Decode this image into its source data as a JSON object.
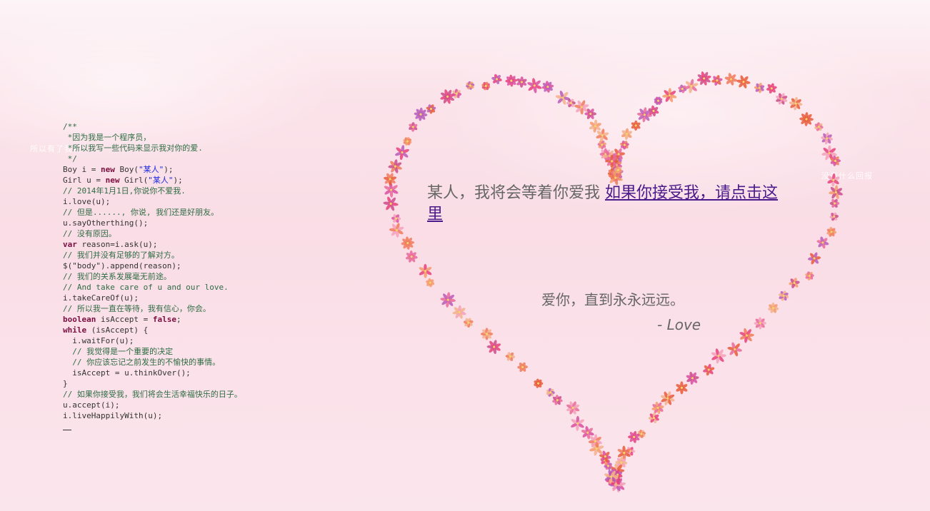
{
  "background_texts": {
    "left": "所以有了我们",
    "right": "没有什么回报"
  },
  "code_lines": [
    [
      {
        "t": "/**",
        "c": "cmt"
      }
    ],
    [
      {
        "t": " *因为我是一个程序员，",
        "c": "cmt"
      }
    ],
    [
      {
        "t": " *所以我写一些代码来显示我对你的爱.",
        "c": "cmt"
      }
    ],
    [
      {
        "t": " */",
        "c": "cmt"
      }
    ],
    [
      {
        "t": "Boy i = ",
        "c": ""
      },
      {
        "t": "new",
        "c": "kw"
      },
      {
        "t": " Boy(",
        "c": ""
      },
      {
        "t": "\"某人\"",
        "c": "str"
      },
      {
        "t": ");",
        "c": ""
      }
    ],
    [
      {
        "t": "Girl u = ",
        "c": ""
      },
      {
        "t": "new",
        "c": "kw"
      },
      {
        "t": " Girl(",
        "c": ""
      },
      {
        "t": "\"某人\"",
        "c": "str"
      },
      {
        "t": ");",
        "c": ""
      }
    ],
    [
      {
        "t": "// 2014年1月1日,你说你不爱我.",
        "c": "cmt"
      }
    ],
    [
      {
        "t": "i.love(u);",
        "c": ""
      }
    ],
    [
      {
        "t": "// 但是......, 你说, 我们还是好朋友。",
        "c": "cmt"
      }
    ],
    [
      {
        "t": "u.sayOtherthing();",
        "c": ""
      }
    ],
    [
      {
        "t": "// 没有原因。",
        "c": "cmt"
      }
    ],
    [
      {
        "t": "var",
        "c": "kw"
      },
      {
        "t": " reason=i.ask(u);",
        "c": ""
      }
    ],
    [
      {
        "t": "// 我们并没有足够的了解对方。",
        "c": "cmt"
      }
    ],
    [
      {
        "t": "$(\"body\").append(reason);",
        "c": ""
      }
    ],
    [
      {
        "t": "// 我们的关系发展毫无前途。",
        "c": "cmt"
      }
    ],
    [
      {
        "t": "// And take care of u and our love.",
        "c": "cmt"
      }
    ],
    [
      {
        "t": "i.takeCareOf(u);",
        "c": ""
      }
    ],
    [
      {
        "t": "// 所以我一直在等待，我有信心，你会。",
        "c": "cmt"
      }
    ],
    [
      {
        "t": "boolean",
        "c": "kw"
      },
      {
        "t": " isAccept = ",
        "c": ""
      },
      {
        "t": "false",
        "c": "kw"
      },
      {
        "t": ";",
        "c": ""
      }
    ],
    [
      {
        "t": "while",
        "c": "kw"
      },
      {
        "t": " (isAccept) {",
        "c": ""
      }
    ],
    [
      {
        "t": "  i.waitFor(u);",
        "c": ""
      }
    ],
    [
      {
        "t": "  // 我觉得是一个重要的决定",
        "c": "cmt"
      }
    ],
    [
      {
        "t": "  // 你应该忘记之前发生的不愉快的事情。",
        "c": "cmt"
      }
    ],
    [
      {
        "t": "  isAccept = u.thinkOver();",
        "c": ""
      }
    ],
    [
      {
        "t": "}",
        "c": ""
      }
    ],
    [
      {
        "t": "// 如果你接受我，我们将会生活幸福快乐的日子。",
        "c": "cmt"
      }
    ],
    [
      {
        "t": "u.accept(i);",
        "c": ""
      }
    ],
    [
      {
        "t": "i.liveHappilyWith(u);",
        "c": ""
      }
    ]
  ],
  "message": {
    "text": "某人，我将会等着你爱我 ",
    "link_label": "如果你接受我，请点击这里",
    "line2": "爱你，直到永永远远。",
    "signature": "- Love"
  },
  "colors": {
    "background": "#fadde6",
    "text": "#666666",
    "link": "#4b1a8a",
    "code_comment": "#2e6b43",
    "code_keyword": "#7a0f3f",
    "code_string": "#1f2ce0",
    "flower_palette": [
      "#e8407a",
      "#f07a5a",
      "#d94fa0",
      "#f5a0b8",
      "#e85a3a",
      "#c94b8a",
      "#f3b08a",
      "#b85ab8",
      "#e86a9a",
      "#f49a6a"
    ]
  },
  "icons": {
    "heart": "flower-heart-icon",
    "cursor": "text-cursor-icon"
  }
}
